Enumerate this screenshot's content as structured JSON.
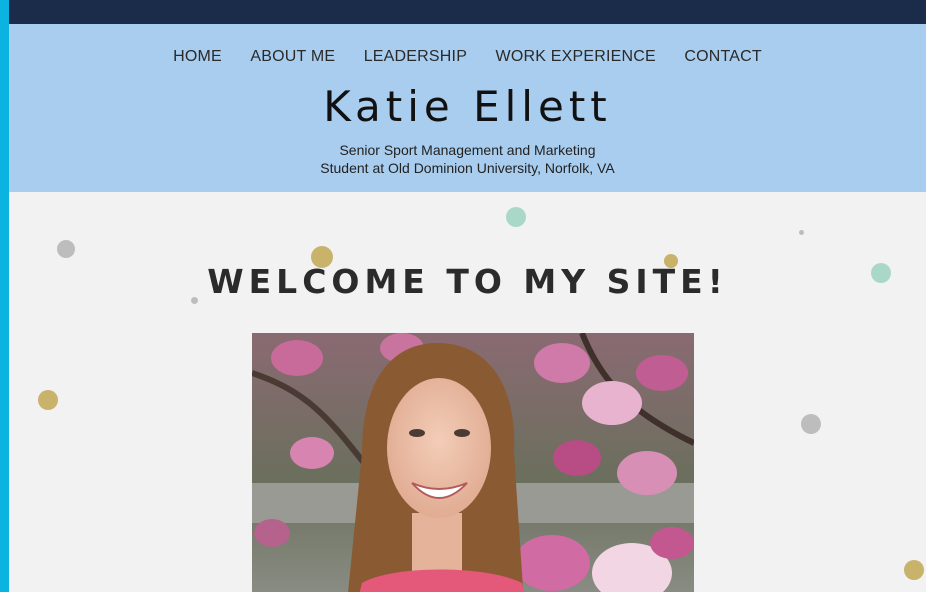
{
  "nav": {
    "items": [
      "HOME",
      "ABOUT ME",
      "LEADERSHIP",
      "WORK EXPERIENCE",
      "CONTACT"
    ]
  },
  "header": {
    "name": "Katie Ellett",
    "subtitle_line1": "Senior Sport Management and Marketing",
    "subtitle_line2": "Student at Old Dominion University, Norfolk, VA"
  },
  "main": {
    "welcome": "WELCOME TO MY SITE!"
  },
  "colors": {
    "header_bg": "#a9cdee",
    "topbar": "#1b2b4a",
    "outer_border": "#0bb3e0",
    "dot_gold": "#c9b26a",
    "dot_mint": "#a9d8c8",
    "dot_gray": "#bdbdbd"
  }
}
